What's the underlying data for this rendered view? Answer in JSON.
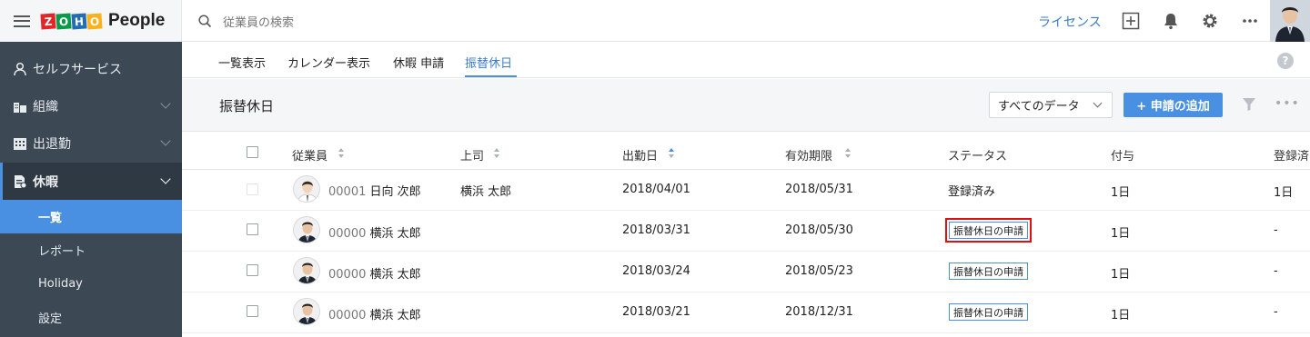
{
  "app": {
    "name": "People",
    "logo_letters": [
      "Z",
      "O",
      "H",
      "O"
    ],
    "logo_colors": [
      "#e42527",
      "#089949",
      "#226db4",
      "#f9b21d"
    ]
  },
  "topbar": {
    "search_placeholder": "従業員の検索",
    "license_link": "ライセンス",
    "icons": [
      "add-square-icon",
      "bell-icon",
      "gear-icon",
      "more-icon"
    ]
  },
  "sidebar": {
    "items": [
      {
        "label": "セルフサービス",
        "icon": "person-icon"
      },
      {
        "label": "組織",
        "icon": "organization-icon"
      },
      {
        "label": "出退勤",
        "icon": "calendar-grid-icon"
      },
      {
        "label": "休暇",
        "icon": "leave-icon",
        "expanded": true
      }
    ],
    "subitems": [
      {
        "label": "一覧",
        "active": true
      },
      {
        "label": "レポート"
      },
      {
        "label": "Holiday"
      },
      {
        "label": "設定"
      }
    ]
  },
  "tabs": [
    {
      "label": "一覧表示"
    },
    {
      "label": "カレンダー表示"
    },
    {
      "label": "休暇 申請"
    },
    {
      "label": "振替休日",
      "active": true
    }
  ],
  "page": {
    "title": "振替休日",
    "filter_value": "すべてのデータ",
    "add_button": "+ 申請の追加"
  },
  "table": {
    "columns": [
      "従業員",
      "上司",
      "出勤日",
      "有効期限",
      "ステータス",
      "付与",
      "登録済"
    ],
    "rows": [
      {
        "emp_id": "00001",
        "emp_name": "日向 次郎",
        "manager": "横浜 太郎",
        "work_date": "2018/04/01",
        "expiry": "2018/05/31",
        "status": "登録済み",
        "status_badge": false,
        "granted": "1日",
        "registered": "1日",
        "checkbox_disabled": true
      },
      {
        "emp_id": "00000",
        "emp_name": "横浜 太郎",
        "manager": "",
        "work_date": "2018/03/31",
        "expiry": "2018/05/30",
        "status": "振替休日の申請",
        "status_badge": true,
        "highlight": true,
        "granted": "1日",
        "registered": "-"
      },
      {
        "emp_id": "00000",
        "emp_name": "横浜 太郎",
        "manager": "",
        "work_date": "2018/03/24",
        "expiry": "2018/05/23",
        "status": "振替休日の申請",
        "status_badge": true,
        "granted": "1日",
        "registered": "-"
      },
      {
        "emp_id": "00000",
        "emp_name": "横浜 太郎",
        "manager": "",
        "work_date": "2018/03/21",
        "expiry": "2018/12/31",
        "status": "振替休日の申請",
        "status_badge": true,
        "granted": "1日",
        "registered": "-"
      }
    ]
  },
  "colors": {
    "accent": "#4a90e2",
    "sidebar": "#3d4855",
    "highlight_border": "#e01010"
  }
}
